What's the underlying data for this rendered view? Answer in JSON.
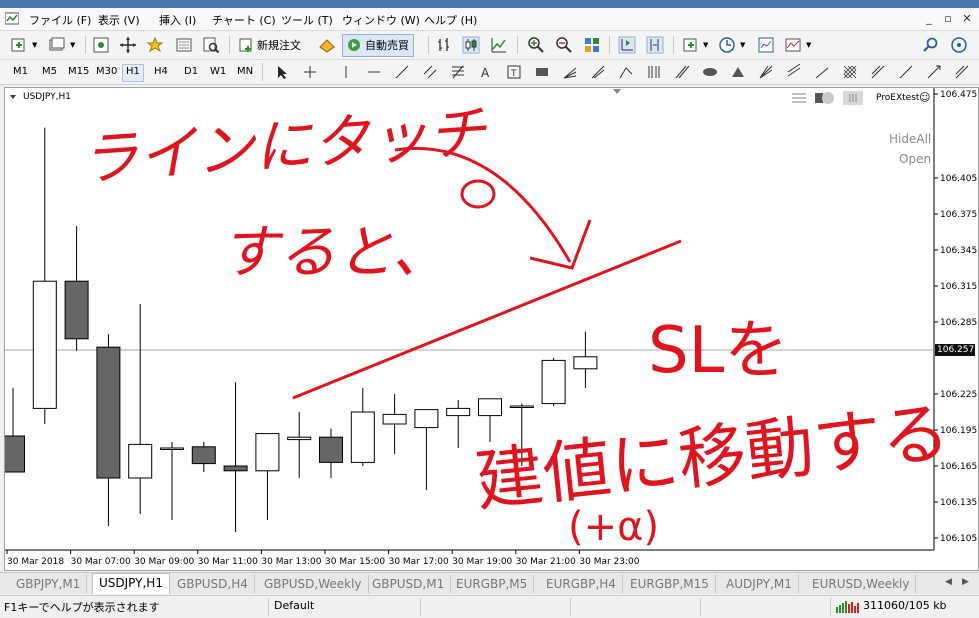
{
  "menu": {
    "items": [
      "ファイル (F)",
      "表示 (V)",
      "挿入 (I)",
      "チャート (C)",
      "ツール (T)",
      "ウィンドウ (W)",
      "ヘルプ (H)"
    ]
  },
  "toolbar": {
    "new_order_label": "新規注文",
    "auto_trade_label": "自動売買"
  },
  "timeframes": [
    "M1",
    "M5",
    "M15",
    "M30",
    "H1",
    "H4",
    "D1",
    "W1",
    "MN"
  ],
  "active_timeframe": "H1",
  "chart": {
    "symbol_label": "USDJPY,H1",
    "ea_name": "ProEXtest",
    "hideall_label": "HideAll",
    "open_label": "Open",
    "current_price": "106.257",
    "price_ticks": [
      "106.475",
      "106.405",
      "106.375",
      "106.345",
      "106.315",
      "106.285",
      "106.225",
      "106.195",
      "106.165",
      "106.135",
      "106.105"
    ],
    "time_labels": [
      "30 Mar 2018",
      "30 Mar 07:00",
      "30 Mar 09:00",
      "30 Mar 11:00",
      "30 Mar 13:00",
      "30 Mar 15:00",
      "30 Mar 17:00",
      "30 Mar 19:00",
      "30 Mar 21:00",
      "30 Mar 23:00"
    ]
  },
  "chart_data": {
    "type": "candlestick",
    "ylim": [
      106.095,
      106.48
    ],
    "current_price": 106.257,
    "candles": [
      {
        "o": 106.19,
        "h": 106.23,
        "l": 106.16,
        "c": 106.16
      },
      {
        "o": 106.213,
        "h": 106.447,
        "l": 106.2,
        "c": 106.319
      },
      {
        "o": 106.319,
        "h": 106.365,
        "l": 106.261,
        "c": 106.271
      },
      {
        "o": 106.264,
        "h": 106.275,
        "l": 106.115,
        "c": 106.155
      },
      {
        "o": 106.155,
        "h": 106.3,
        "l": 106.125,
        "c": 106.183
      },
      {
        "o": 106.18,
        "h": 106.185,
        "l": 106.12,
        "c": 106.18
      },
      {
        "o": 106.181,
        "h": 106.185,
        "l": 106.16,
        "c": 106.167
      },
      {
        "o": 106.165,
        "h": 106.235,
        "l": 106.11,
        "c": 106.161
      },
      {
        "o": 106.161,
        "h": 106.192,
        "l": 106.12,
        "c": 106.192
      },
      {
        "o": 106.187,
        "h": 106.21,
        "l": 106.155,
        "c": 106.189
      },
      {
        "o": 106.189,
        "h": 106.196,
        "l": 106.155,
        "c": 106.168
      },
      {
        "o": 106.168,
        "h": 106.23,
        "l": 106.165,
        "c": 106.21
      },
      {
        "o": 106.2,
        "h": 106.225,
        "l": 106.175,
        "c": 106.208
      },
      {
        "o": 106.197,
        "h": 106.21,
        "l": 106.145,
        "c": 106.212
      },
      {
        "o": 106.207,
        "h": 106.22,
        "l": 106.18,
        "c": 106.213
      },
      {
        "o": 106.207,
        "h": 106.22,
        "l": 106.185,
        "c": 106.221
      },
      {
        "o": 106.214,
        "h": 106.217,
        "l": 106.165,
        "c": 106.215
      },
      {
        "o": 106.217,
        "h": 106.255,
        "l": 106.215,
        "c": 106.253
      },
      {
        "o": 106.246,
        "h": 106.277,
        "l": 106.23,
        "c": 106.256
      }
    ]
  },
  "tabs": {
    "items": [
      "GBPJPY,M1",
      "USDJPY,H1",
      "GBPUSD,H4",
      "GBPUSD,Weekly",
      "GBPUSD,M1",
      "EURGBP,M5",
      "EURGBP,H4",
      "EURGBP,M15",
      "AUDJPY,M1",
      "EURUSD,Weekly"
    ],
    "active_index": 1
  },
  "status": {
    "help_text": "F1キーでヘルプが表示されます",
    "profile": "Default",
    "traffic": "311060/105 kb"
  },
  "annotations": {
    "line1": "ラインにタッチ",
    "line2": "すると、",
    "sl_text": "SLを",
    "line3": "建値に移動する",
    "plus_alpha": "(+α)",
    "color": "#e0141e"
  }
}
